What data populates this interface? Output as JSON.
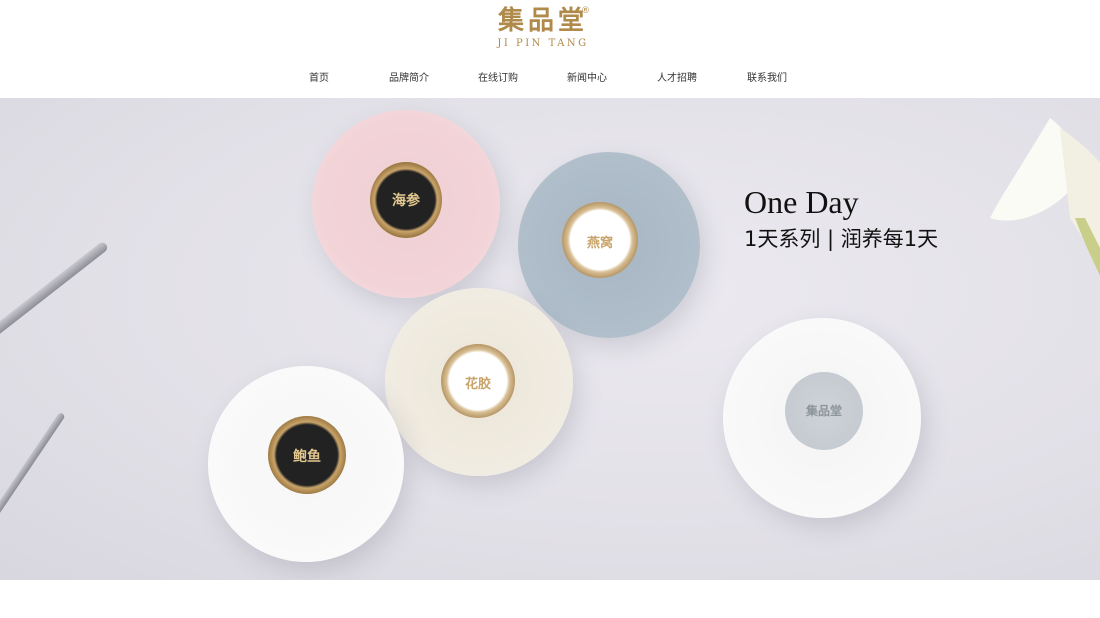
{
  "brand": {
    "name_cn": "集品堂",
    "name_en": "JI PIN TANG",
    "reg": "®"
  },
  "nav": [
    {
      "label": "首页"
    },
    {
      "label": "品牌简介"
    },
    {
      "label": "在线订购"
    },
    {
      "label": "新闻中心"
    },
    {
      "label": "人才招聘"
    },
    {
      "label": "联系我们"
    }
  ],
  "hero": {
    "title": "One Day",
    "subtitle": "1天系列 | 润养每1天",
    "jars": [
      {
        "label": "海参"
      },
      {
        "label": "燕窝"
      },
      {
        "label": "花胶"
      },
      {
        "label": "鲍鱼"
      }
    ],
    "upturned_jar_logo": "集品堂"
  },
  "colors": {
    "brand_gold": "#b08a4a",
    "hero_bg": "#e2e0e7"
  }
}
